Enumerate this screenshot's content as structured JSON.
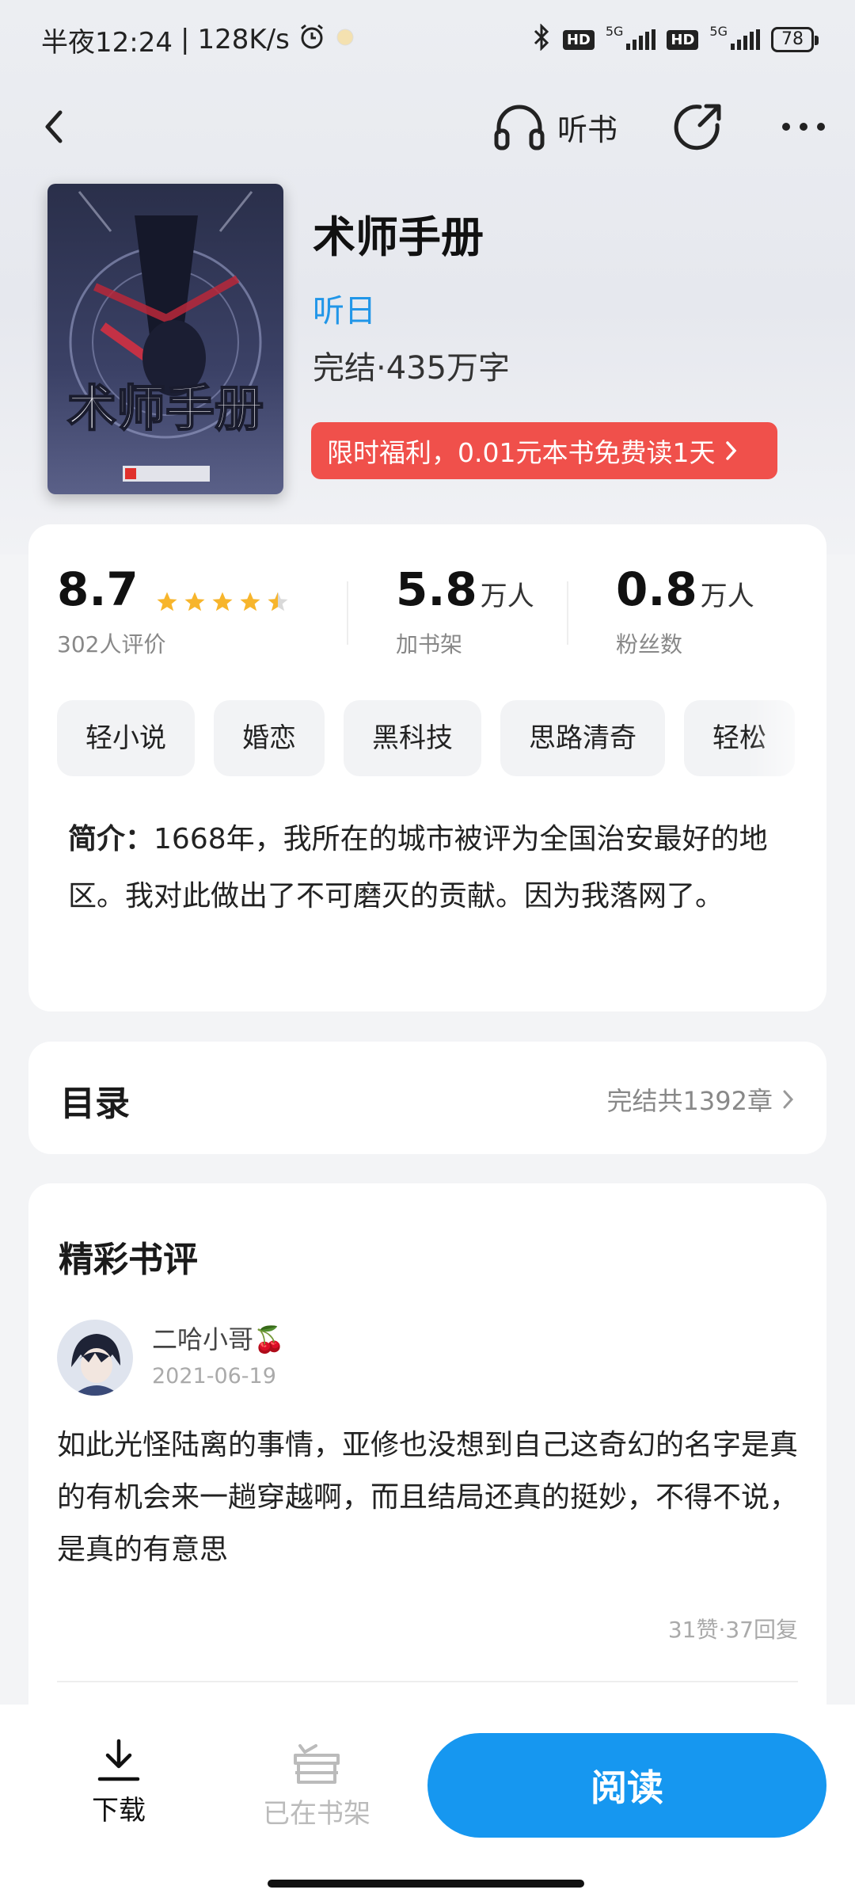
{
  "status_bar": {
    "time": "半夜12:24",
    "net_speed": "128K/s",
    "hd1": "HD",
    "hd2": "HD",
    "net1": "5G",
    "net2": "5G",
    "battery": "78"
  },
  "nav": {
    "listen_label": "听书"
  },
  "book": {
    "title": "术师手册",
    "author": "听日",
    "meta": "完结·435万字",
    "promo": "限时福利，0.01元本书免费读1天",
    "cover_text": "术师手册"
  },
  "stats": {
    "rating": "8.7",
    "rating_label": "302人评价",
    "rating_stars": 4.5,
    "shelf_num": "5.8",
    "shelf_unit": "万人",
    "shelf_label": "加书架",
    "fans_num": "0.8",
    "fans_unit": "万人",
    "fans_label": "粉丝数"
  },
  "tags": [
    "轻小说",
    "婚恋",
    "黑科技",
    "思路清奇",
    "轻松"
  ],
  "intro": {
    "label": "简介：",
    "text": "1668年，我所在的城市被评为全国治安最好的地区。我对此做出了不可磨灭的贡献。因为我落网了。"
  },
  "toc": {
    "title": "目录",
    "summary": "完结共1392章"
  },
  "reviews": {
    "title": "精彩书评",
    "items": [
      {
        "user": "二哈小哥🍒",
        "date": "2021-06-19",
        "text": "如此光怪陆离的事情，亚修也没想到自己这奇幻的名字是真的有机会来一趟穿越啊，而且结局还真的挺妙，不得不说，是真的有意思",
        "stats": "31赞·37回复"
      }
    ]
  },
  "bottom_bar": {
    "download": "下载",
    "shelf": "已在书架",
    "read": "阅读"
  },
  "colors": {
    "accent": "#1697f0",
    "author": "#2196e8",
    "promo": "#f0504b",
    "star": "#f7b52c"
  }
}
